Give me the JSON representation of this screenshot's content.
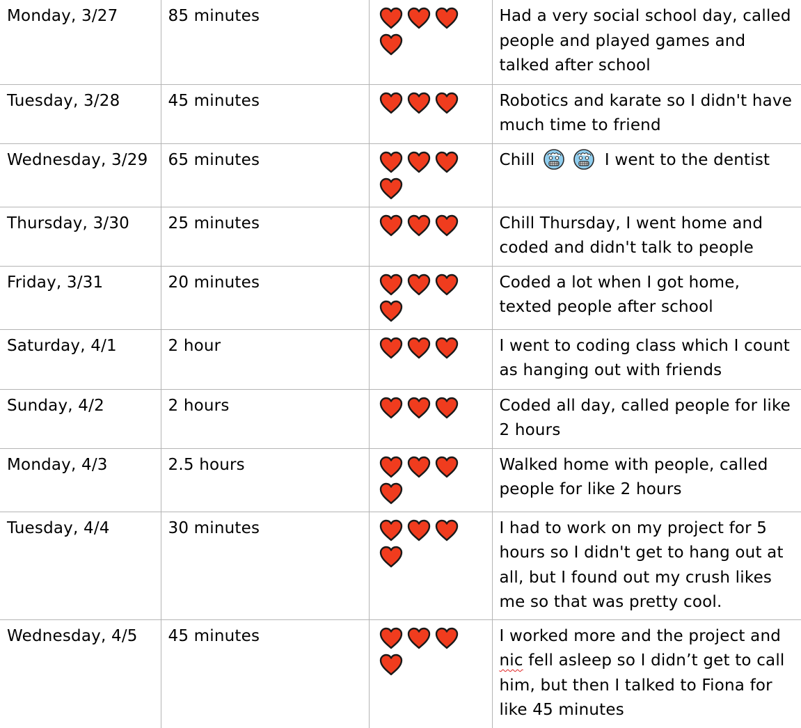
{
  "icons": {
    "heart": "red-heart-icon",
    "cold_face": "cold-face-emoji-icon"
  },
  "colors": {
    "heart_fill": "#f03c1e",
    "heart_outline": "#1a1a1a",
    "cold_face_fill": "#8fcdee",
    "grid_line": "#b4b4b4",
    "spell_check": "#e02020"
  },
  "rows": [
    {
      "day": "Monday, 3/27",
      "duration": "85 minutes",
      "hearts": 4,
      "note": "Had a very social school day, called people and played games and talked after school"
    },
    {
      "day": "Tuesday, 3/28",
      "duration": "45 minutes",
      "hearts": 3,
      "note": "Robotics and karate so I didn't have much time to friend"
    },
    {
      "day": "Wednesday, 3/29",
      "duration": "65 minutes",
      "hearts": 4,
      "note_before": "Chill",
      "note_after": "I went to the dentist"
    },
    {
      "day": "Thursday, 3/30",
      "duration": "25 minutes",
      "hearts": 3,
      "note": "Chill Thursday, I went home and coded and didn't talk to people"
    },
    {
      "day": "Friday, 3/31",
      "duration": "20 minutes",
      "hearts": 4,
      "note": "Coded a lot when I got home, texted people after school"
    },
    {
      "day": "Saturday, 4/1",
      "duration": "2 hour",
      "hearts": 3,
      "note": "I went to coding class which I count as hanging out with friends"
    },
    {
      "day": "Sunday, 4/2",
      "duration": "2 hours",
      "hearts": 3,
      "note": "Coded all day, called people for like 2 hours"
    },
    {
      "day": "Monday, 4/3",
      "duration": "2.5 hours",
      "hearts": 4,
      "note": "Walked home with people, called people for like 2 hours"
    },
    {
      "day": "Tuesday, 4/4",
      "duration": "30 minutes",
      "hearts": 4,
      "note": "I had to work on my project for 5 hours so I didn't get to hang out at all, but I found out my crush likes me so that was pretty cool."
    },
    {
      "day": "Wednesday, 4/5",
      "duration": "45 minutes",
      "hearts": 4,
      "note_a": "I worked more and the project and ",
      "note_misspelled": "nic",
      "note_b": " fell asleep so I didn’t get to call him, but then I talked to Fiona for like 45 minutes"
    }
  ]
}
